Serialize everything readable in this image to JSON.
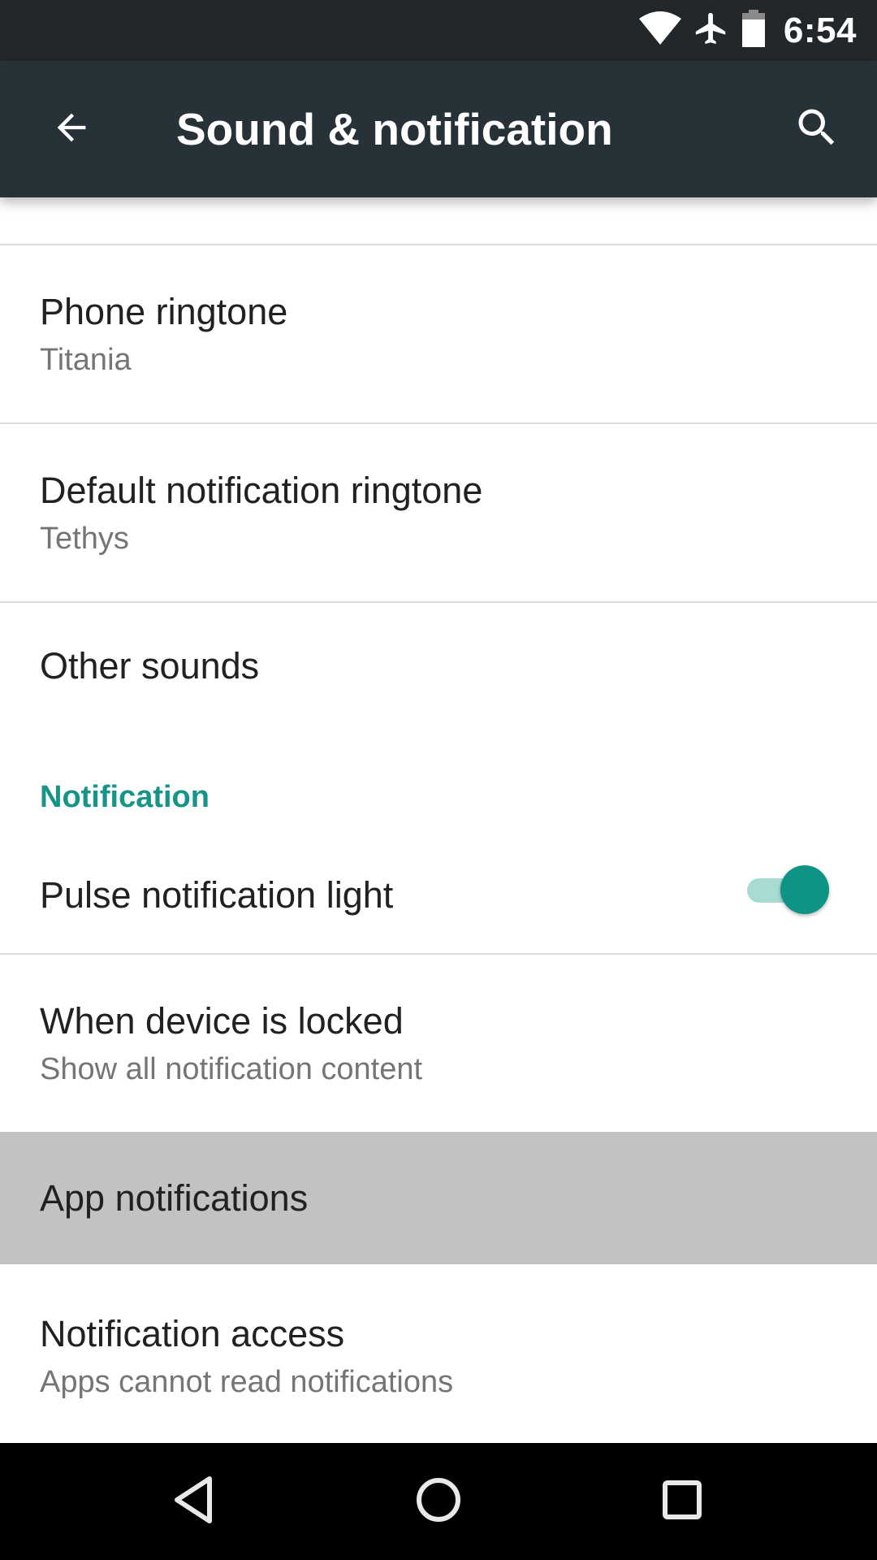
{
  "status_bar": {
    "time": "6:54",
    "icons": [
      "wifi-icon",
      "airplane-mode-icon",
      "battery-icon"
    ]
  },
  "app_bar": {
    "title": "Sound & notification",
    "back_icon": "arrow-back-icon",
    "search_icon": "search-icon",
    "background_color": "#263238"
  },
  "list": {
    "items": [
      {
        "title": "Phone ringtone",
        "summary": "Titania"
      },
      {
        "title": "Default notification ringtone",
        "summary": "Tethys"
      },
      {
        "title": "Other sounds"
      }
    ],
    "section_header": "Notification",
    "notification_items": [
      {
        "title": "Pulse notification light",
        "toggle": true
      },
      {
        "title": "When device is locked",
        "summary": "Show all notification content"
      },
      {
        "title": "App notifications",
        "pressed": true
      },
      {
        "title": "Notification access",
        "summary": "Apps cannot read notifications"
      }
    ]
  },
  "colors": {
    "accent": "#159487",
    "toggle_thumb": "#0e9485",
    "toggle_track": "#a9dbd5",
    "pressed_row": "#c2c2c2"
  },
  "nav_bar": {
    "buttons": [
      "back-icon",
      "home-icon",
      "recents-icon"
    ]
  }
}
